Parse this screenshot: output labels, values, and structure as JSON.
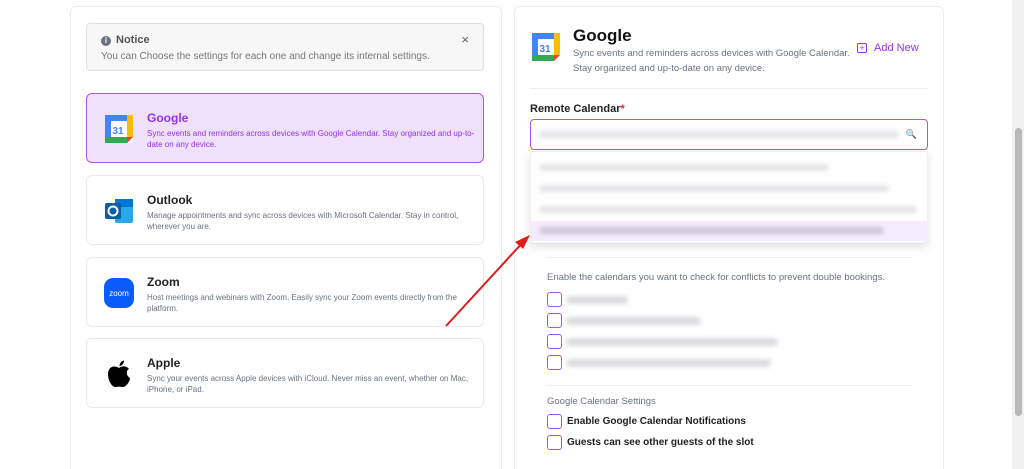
{
  "notice": {
    "title": "Notice",
    "text": "You can Choose the settings for each one and change its internal settings.",
    "close": "×",
    "info_icon": "i"
  },
  "providers": [
    {
      "title": "Google",
      "desc": "Sync events and reminders across devices with Google Calendar. Stay organized and up-to-date on any device.",
      "icon": "google-calendar-icon",
      "active": true
    },
    {
      "title": "Outlook",
      "desc": "Manage appointments and sync across devices with Microsoft Calendar. Stay in control, wherever you are.",
      "icon": "outlook-icon",
      "active": false
    },
    {
      "title": "Zoom",
      "desc": "Host meetings and webinars with Zoom. Easily sync your Zoom events directly from the platform.",
      "icon": "zoom-icon",
      "active": false
    },
    {
      "title": "Apple",
      "desc": "Sync your events across Apple devices with iCloud. Never miss an event, whether on Mac, iPhone, or iPad.",
      "icon": "apple-icon",
      "active": false
    }
  ],
  "right": {
    "title": "Google",
    "desc": "Sync events and reminders across devices with Google Calendar. Stay organized and up-to-date on any device.",
    "add_new": "Add New",
    "remote_label": "Remote Calendar",
    "required_mark": "*",
    "search_icon": "🔍",
    "conflict_text": "Enable the calendars you want to check for conflicts to prevent double bookings.",
    "settings_title": "Google Calendar Settings",
    "options": [
      {
        "label": "Enable Google Calendar Notifications",
        "checked": false
      },
      {
        "label": "Guests can see other guests of the slot",
        "checked": false
      }
    ]
  },
  "colors": {
    "accent": "#9333ea",
    "accent_bg": "#efe1fb",
    "arrow": "#e01c1c"
  }
}
